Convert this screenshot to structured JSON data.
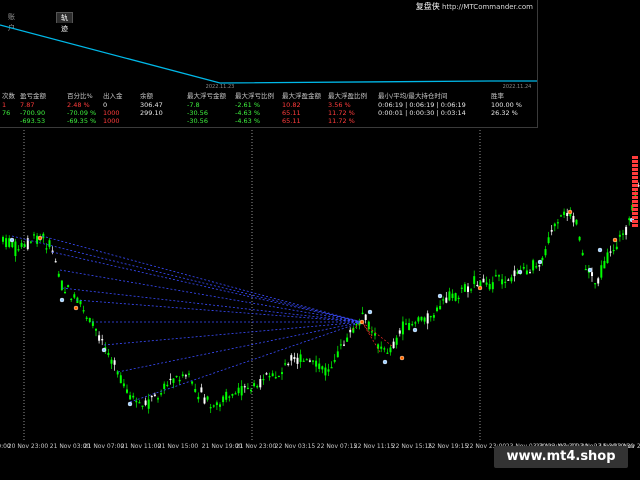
{
  "panel": {
    "title_cn": "复盘侠",
    "title_url": "http://MTCommander.com",
    "tabs": [
      {
        "label": "账户",
        "active": false
      },
      {
        "label": "轨迹",
        "active": true
      }
    ],
    "mini_dates": [
      "2022.11.23",
      "2022.11.24"
    ],
    "table": {
      "headers": [
        "次数",
        "盈亏金额",
        "百分比%",
        "出入金",
        "余额",
        "最大浮亏金额",
        "最大浮亏比例",
        "最大浮盈金额",
        "最大浮盈比例",
        "最小/平均/最大持仓时间",
        "胜率"
      ],
      "rows": [
        [
          "1",
          "7.87",
          "2.48 %",
          "0",
          "306.47",
          "-7.8",
          "-2.61 %",
          "10.82",
          "3.56 %",
          "0:06:19 | 0:06:19 | 0:06:19",
          "100.00 %"
        ],
        [
          "76",
          "-700.90",
          "-70.09 %",
          "1000",
          "299.10",
          "-30.56",
          "-4.63 %",
          "65.11",
          "11.72 %",
          "0:00:01 | 0:00:30 | 0:03:14",
          "26.32 %"
        ],
        [
          "",
          "-693.53",
          "-69.35 %",
          "1000",
          "",
          "-30.56",
          "-4.63 %",
          "65.11",
          "11.72 %",
          "",
          ""
        ]
      ]
    }
  },
  "xaxis": [
    "0:00",
    "20 Nov 23:00",
    "21 Nov 03:00",
    "21 Nov 07:00",
    "21 Nov 11:00",
    "21 Nov 15:00",
    "21 Nov 19:00",
    "21 Nov 23:00",
    "22 Nov 03:15",
    "22 Nov 07:15",
    "22 Nov 11:15",
    "22 Nov 15:15",
    "22 Nov 19:15",
    "22 Nov 23:00",
    "23 Nov 03:30",
    "23 Nov 07:30",
    "23 Nov 11:30",
    "23 Nov 15:30",
    "23 Nov 19:30",
    "23 Nov 23:30"
  ],
  "watermark": "www.mt4.shop",
  "colors": {
    "bull": "#00ff00",
    "bear": "#ffffff",
    "fan": "#3a4cff",
    "mini_line": "#00b8e8",
    "separator": "#cfcfcf"
  }
}
